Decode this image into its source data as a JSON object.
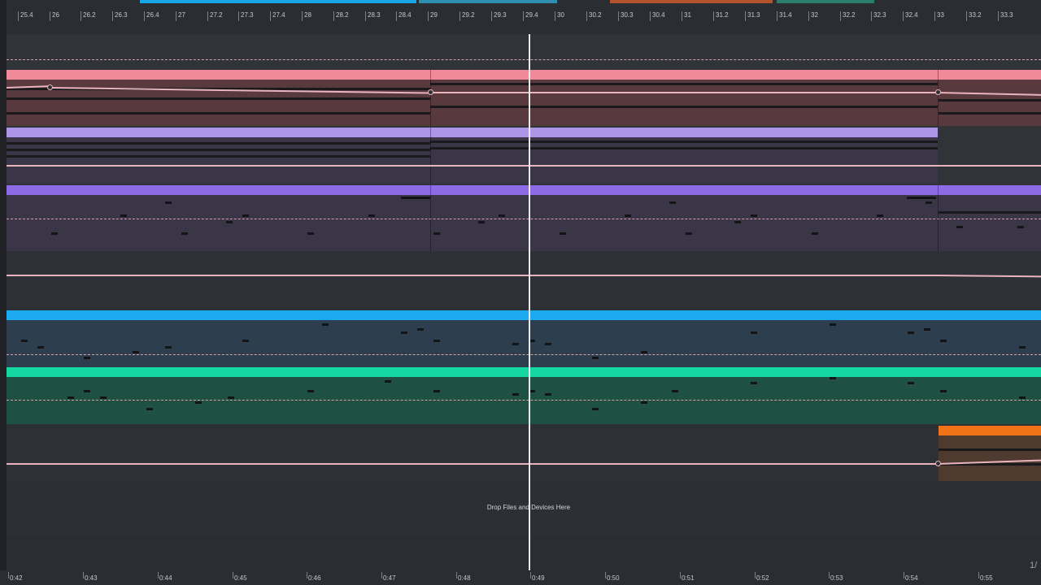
{
  "arrangement": {
    "bar_labels": [
      "25.4",
      "26",
      "26.2",
      "26.3",
      "26.4",
      "27",
      "27.2",
      "27.3",
      "27.4",
      "28",
      "28.2",
      "28.3",
      "28.4",
      "29",
      "29.2",
      "29.3",
      "29.4",
      "30",
      "30.2",
      "30.3",
      "30.4",
      "31",
      "31.2",
      "31.3",
      "31.4",
      "32",
      "32.2",
      "32.3",
      "32.4",
      "33",
      "33.2",
      "33.3"
    ],
    "time_labels": [
      "0:42",
      "0:43",
      "0:44",
      "0:45",
      "0:46",
      "0:47",
      "0:48",
      "0:49",
      "0:50",
      "0:51",
      "0:52",
      "0:53",
      "0:54",
      "0:55"
    ],
    "drop_zone_text": "Drop Files and Devices Here",
    "zoom_indicator": "1/",
    "colors": {
      "track_pink": "#f08a9a",
      "track_lavender": "#ad95e8",
      "track_purple": "#8e6be6",
      "track_blue": "#1da9ef",
      "track_green": "#15d7a2",
      "track_orange": "#f07417",
      "automation": "#eab4bf"
    }
  }
}
